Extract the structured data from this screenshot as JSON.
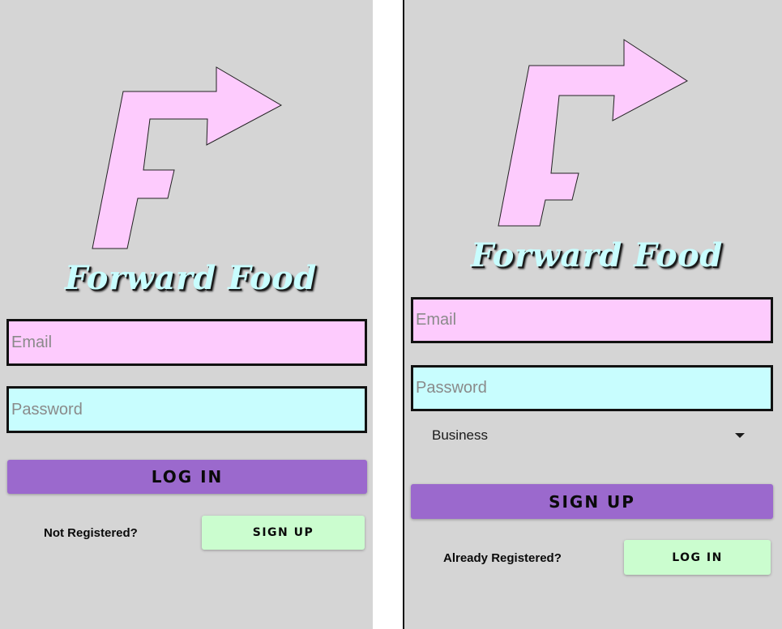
{
  "login_screen": {
    "brand": "Forward Food",
    "email_placeholder": "Email",
    "password_placeholder": "Password",
    "login_label": "LOG IN",
    "prompt": "Not Registered?",
    "signup_label": "SIGN UP"
  },
  "signup_screen": {
    "brand": "Forward Food",
    "email_placeholder": "Email",
    "password_placeholder": "Password",
    "account_type": "Business",
    "signup_label": "SIGN UP",
    "prompt": "Already Registered?",
    "login_label": "LOG IN"
  },
  "colors": {
    "background": "#d5d5d5",
    "logo_pink": "#fdcbfd",
    "logo_text": "#c8fdfe",
    "primary_button": "#9b69cd",
    "secondary_button": "#cbfdcf"
  },
  "icons": {
    "logo": "forward-arrow-f-logo-icon",
    "dropdown": "caret-down-icon"
  }
}
